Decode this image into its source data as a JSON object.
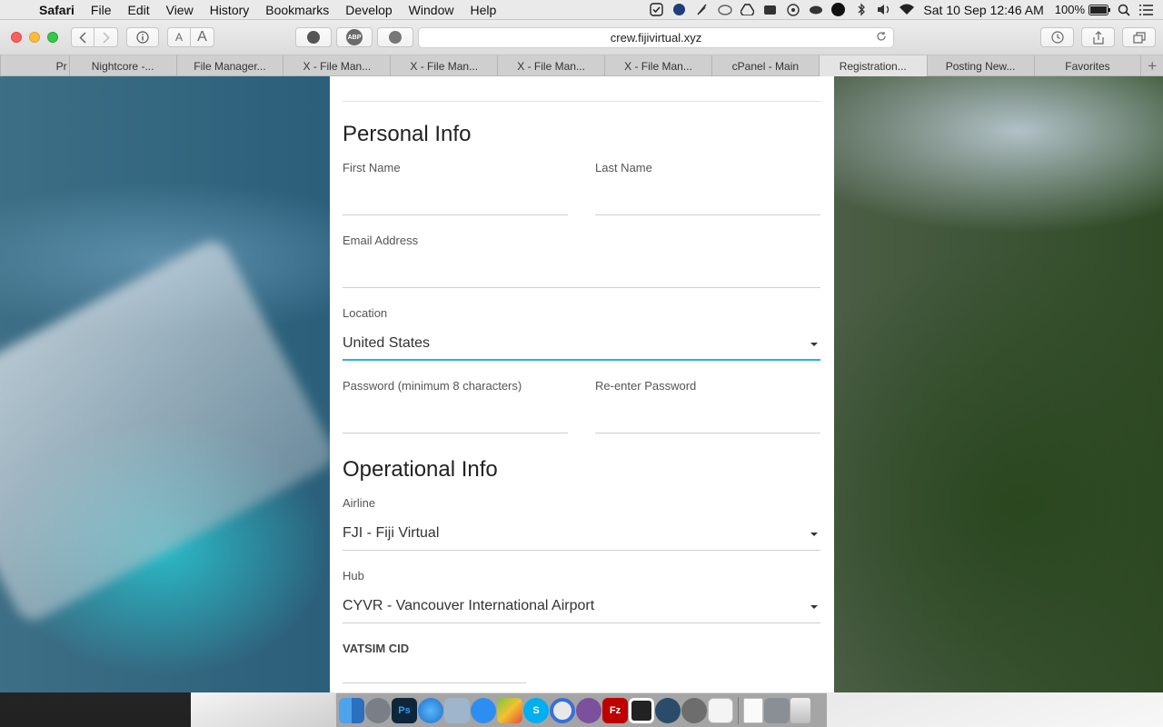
{
  "menubar": {
    "app_name": "Safari",
    "items": [
      "File",
      "Edit",
      "View",
      "History",
      "Bookmarks",
      "Develop",
      "Window",
      "Help"
    ],
    "clock": "Sat 10 Sep  12:46 AM",
    "battery": "100%"
  },
  "toolbar": {
    "font_small": "A",
    "font_large": "A",
    "extension_abp": "ABP",
    "url": "crew.fijivirtual.xyz"
  },
  "tabs": [
    {
      "label": "Pr",
      "active": false
    },
    {
      "label": "Nightcore -...",
      "active": false
    },
    {
      "label": "File Manager...",
      "active": false
    },
    {
      "label": "X - File Man...",
      "active": false
    },
    {
      "label": "X - File Man...",
      "active": false
    },
    {
      "label": "X - File Man...",
      "active": false
    },
    {
      "label": "X - File Man...",
      "active": false
    },
    {
      "label": "cPanel - Main",
      "active": false
    },
    {
      "label": "Registration...",
      "active": true
    },
    {
      "label": "Posting New...",
      "active": false
    },
    {
      "label": "Favorites",
      "active": false
    }
  ],
  "form": {
    "personal_title": "Personal Info",
    "first_name_label": "First Name",
    "last_name_label": "Last Name",
    "email_label": "Email Address",
    "location_label": "Location",
    "location_value": "United States",
    "password_label": "Password (minimum 8 characters)",
    "repassword_label": "Re-enter Password",
    "operational_title": "Operational Info",
    "airline_label": "Airline",
    "airline_value": "FJI - Fiji Virtual",
    "hub_label": "Hub",
    "hub_value": "CYVR - Vancouver International Airport",
    "vatsim_label": "VATSIM CID"
  },
  "dock": {
    "apps": [
      "finder",
      "launchpad",
      "photoshop",
      "safari",
      "preview",
      "app-store",
      "bluestacks",
      "skype",
      "chrome",
      "viber",
      "filezilla",
      "citrix",
      "time-machine",
      "system-preferences",
      "textedit"
    ],
    "stack": [
      "document",
      "downloads",
      "trash"
    ],
    "photoshop_label": "Ps",
    "skype_label": "S",
    "filezilla_label": "Fz"
  },
  "colors": {
    "focus_accent": "#2bb3d6",
    "panel_bg": "#ffffff"
  }
}
